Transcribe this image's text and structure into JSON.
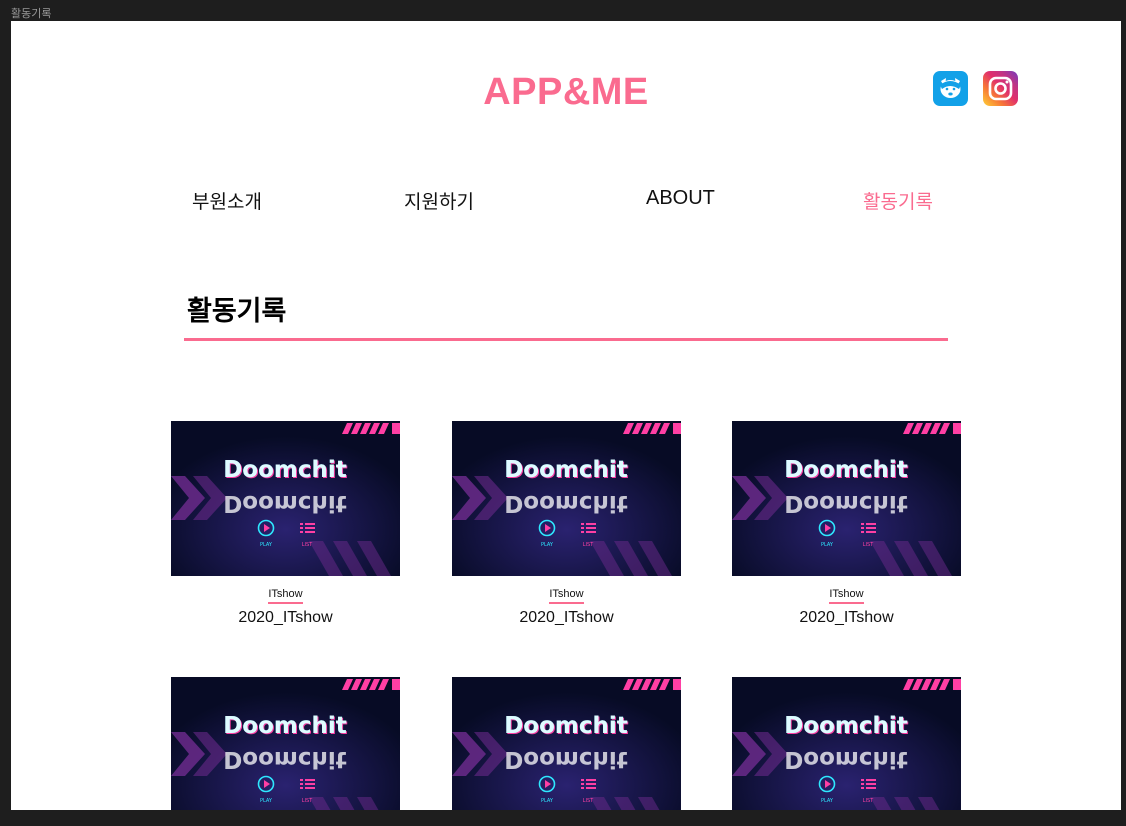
{
  "window": {
    "title": "활동기록"
  },
  "header": {
    "brand": "APP&ME"
  },
  "social": [
    {
      "name": "dog-face-icon",
      "color": "#12a1e8"
    },
    {
      "name": "instagram-icon",
      "color": "#e1306c"
    }
  ],
  "nav": [
    {
      "label": "부원소개"
    },
    {
      "label": "지원하기"
    },
    {
      "label": "ABOUT"
    },
    {
      "label": "활동기록",
      "active": true
    }
  ],
  "section": {
    "title": "활동기록"
  },
  "cards": [
    {
      "tag": "ITshow",
      "title": "2020_ITshow",
      "thumb": {
        "logo": "Doomchit",
        "play": "PLAY",
        "list": "LIST"
      }
    },
    {
      "tag": "ITshow",
      "title": "2020_ITshow",
      "thumb": {
        "logo": "Doomchit",
        "play": "PLAY",
        "list": "LIST"
      }
    },
    {
      "tag": "ITshow",
      "title": "2020_ITshow",
      "thumb": {
        "logo": "Doomchit",
        "play": "PLAY",
        "list": "LIST"
      }
    },
    {
      "thumb": {
        "logo": "Doomchit",
        "play": "PLAY",
        "list": "LIST"
      }
    },
    {
      "thumb": {
        "logo": "Doomchit",
        "play": "PLAY",
        "list": "LIST"
      }
    },
    {
      "thumb": {
        "logo": "Doomchit",
        "play": "PLAY",
        "list": "LIST"
      }
    }
  ],
  "colors": {
    "accent": "#fa6b8f",
    "thumb_bg": "#090d2a",
    "neon_cyan": "#2ee8ff",
    "neon_pink": "#ff3fa4"
  }
}
